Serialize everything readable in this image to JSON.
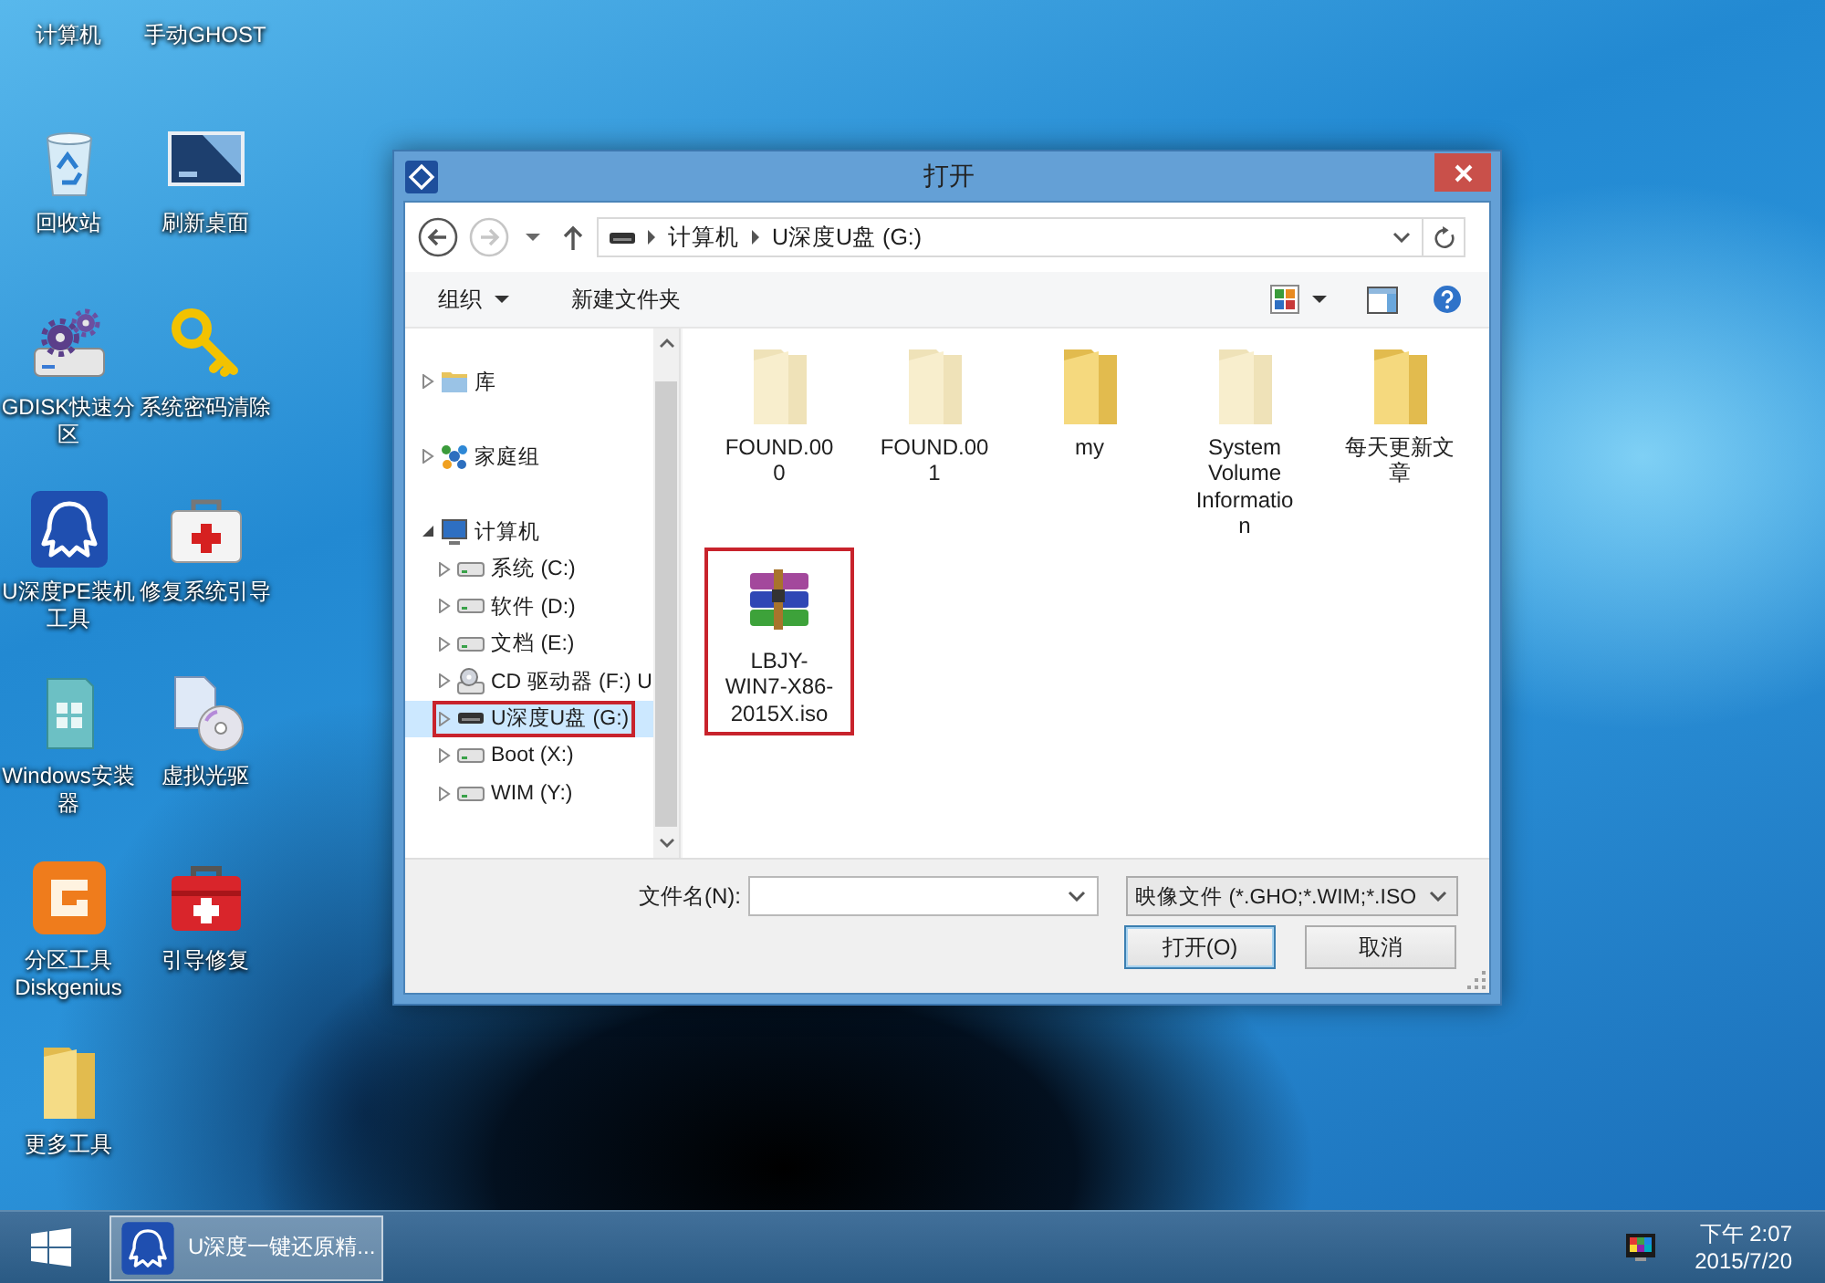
{
  "desktop_icons": [
    {
      "label": "计算机"
    },
    {
      "label": "手动GHOST"
    },
    {
      "label": "回收站",
      "kind": "recycle-bin"
    },
    {
      "label": "刷新桌面",
      "kind": "monitor"
    },
    {
      "label": "GDISK快速分区",
      "kind": "gear-drive"
    },
    {
      "label": "系统密码清除",
      "kind": "key"
    },
    {
      "label": "U深度PE装机工具",
      "kind": "ghost"
    },
    {
      "label": "修复系统引导",
      "kind": "medkit"
    },
    {
      "label": "Windows安装器",
      "kind": "installer"
    },
    {
      "label": "虚拟光驱",
      "kind": "disc"
    },
    {
      "label": "分区工具Diskgenius",
      "kind": "diskgenius"
    },
    {
      "label": "引导修复",
      "kind": "toolbox"
    },
    {
      "label": "更多工具",
      "kind": "folder"
    }
  ],
  "dialog": {
    "title": "打开",
    "nav_buttons": [
      {
        "kind": "back",
        "disabled": false
      },
      {
        "kind": "forward",
        "disabled": true
      }
    ],
    "breadcrumbs": [
      "计算机",
      "U深度U盘 (G:)"
    ],
    "toolbar": {
      "organize": "组织",
      "new_folder": "新建文件夹"
    },
    "nav_tree": [
      {
        "label": "库",
        "kind": "library",
        "expanded": false,
        "selected": false,
        "highlighted": false
      },
      {
        "label": "家庭组",
        "kind": "homegroup",
        "expanded": false,
        "selected": false,
        "highlighted": false
      },
      {
        "label": "计算机",
        "kind": "computer",
        "expanded": true,
        "selected": false,
        "highlighted": false,
        "children": [
          {
            "label": "系统 (C:)",
            "kind": "hdd",
            "expanded": false,
            "selected": false,
            "highlighted": false
          },
          {
            "label": "软件 (D:)",
            "kind": "hdd",
            "expanded": false,
            "selected": false,
            "highlighted": false
          },
          {
            "label": "文档 (E:)",
            "kind": "hdd",
            "expanded": false,
            "selected": false,
            "highlighted": false
          },
          {
            "label": "CD 驱动器 (F:) U",
            "kind": "cd",
            "expanded": false,
            "selected": false,
            "highlighted": false
          },
          {
            "label": "U深度U盘 (G:)",
            "kind": "usb",
            "expanded": false,
            "selected": true,
            "highlighted": true
          },
          {
            "label": "Boot (X:)",
            "kind": "hdd",
            "expanded": false,
            "selected": false,
            "highlighted": false
          },
          {
            "label": "WIM (Y:)",
            "kind": "hdd",
            "expanded": false,
            "selected": false,
            "highlighted": false
          }
        ]
      }
    ],
    "files": [
      {
        "name": "FOUND.000",
        "kind": "folder",
        "hidden": true,
        "selected": false,
        "highlighted": false
      },
      {
        "name": "FOUND.001",
        "kind": "folder",
        "hidden": true,
        "selected": false,
        "highlighted": false
      },
      {
        "name": "my",
        "kind": "folder",
        "hidden": false,
        "selected": false,
        "highlighted": false
      },
      {
        "name": "System Volume Information",
        "kind": "folder",
        "hidden": true,
        "selected": false,
        "highlighted": false
      },
      {
        "name": "每天更新文章",
        "kind": "folder",
        "hidden": false,
        "selected": false,
        "highlighted": false
      },
      {
        "name": "LBJY-WIN7-X86-2015X.iso",
        "kind": "archive",
        "selected": false,
        "highlighted": true
      }
    ],
    "filename_label": "文件名(N):",
    "file_type": "映像文件 (*.GHO;*.WIM;*.ISO",
    "buttons": [
      {
        "label": "打开(O)",
        "default": true
      },
      {
        "label": "取消",
        "default": false
      }
    ]
  },
  "taskbar": {
    "tasks": [
      {
        "label": "U深度一键还原精...",
        "selected": true
      }
    ],
    "clock": {
      "time": "下午 2:07",
      "date": "2015/7/20"
    }
  }
}
